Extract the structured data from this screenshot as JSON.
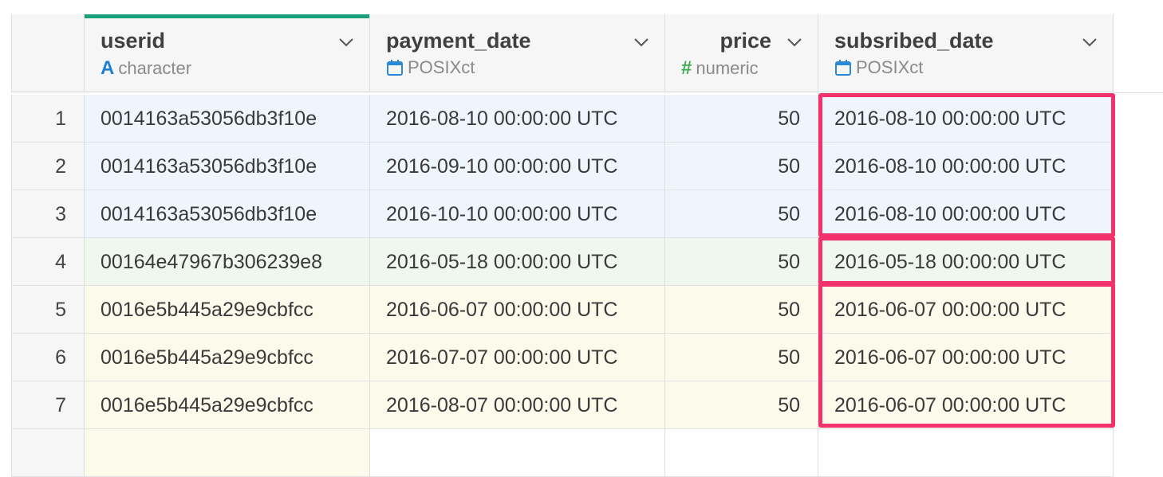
{
  "columns": [
    {
      "name": "userid",
      "type": "character",
      "type_icon": "character-type-icon",
      "type_glyph": "A",
      "active": true,
      "align": "left"
    },
    {
      "name": "payment_date",
      "type": "POSIXct",
      "type_icon": "calendar-icon",
      "type_glyph": "",
      "active": false,
      "align": "left"
    },
    {
      "name": "price",
      "type": "numeric",
      "type_icon": "numeric-type-icon",
      "type_glyph": "#",
      "active": false,
      "align": "right"
    },
    {
      "name": "subsribed_date",
      "type": "POSIXct",
      "type_icon": "calendar-icon",
      "type_glyph": "",
      "active": false,
      "align": "left"
    }
  ],
  "rows": [
    {
      "num": "1",
      "userid": "0014163a53056db3f10e",
      "payment_date": "2016-08-10 00:00:00 UTC",
      "price": "50",
      "subsribed_date": "2016-08-10 00:00:00 UTC",
      "group": "blue"
    },
    {
      "num": "2",
      "userid": "0014163a53056db3f10e",
      "payment_date": "2016-09-10 00:00:00 UTC",
      "price": "50",
      "subsribed_date": "2016-08-10 00:00:00 UTC",
      "group": "blue"
    },
    {
      "num": "3",
      "userid": "0014163a53056db3f10e",
      "payment_date": "2016-10-10 00:00:00 UTC",
      "price": "50",
      "subsribed_date": "2016-08-10 00:00:00 UTC",
      "group": "blue"
    },
    {
      "num": "4",
      "userid": "00164e47967b306239e8",
      "payment_date": "2016-05-18 00:00:00 UTC",
      "price": "50",
      "subsribed_date": "2016-05-18 00:00:00 UTC",
      "group": "green"
    },
    {
      "num": "5",
      "userid": "0016e5b445a29e9cbfcc",
      "payment_date": "2016-06-07 00:00:00 UTC",
      "price": "50",
      "subsribed_date": "2016-06-07 00:00:00 UTC",
      "group": "yellow"
    },
    {
      "num": "6",
      "userid": "0016e5b445a29e9cbfcc",
      "payment_date": "2016-07-07 00:00:00 UTC",
      "price": "50",
      "subsribed_date": "2016-06-07 00:00:00 UTC",
      "group": "yellow"
    },
    {
      "num": "7",
      "userid": "0016e5b445a29e9cbfcc",
      "payment_date": "2016-08-07 00:00:00 UTC",
      "price": "50",
      "subsribed_date": "2016-06-07 00:00:00 UTC",
      "group": "yellow"
    }
  ],
  "highlight_groups": [
    {
      "column": "subsribed_date",
      "rows": [
        "1",
        "2",
        "3"
      ]
    },
    {
      "column": "subsribed_date",
      "rows": [
        "4"
      ]
    },
    {
      "column": "subsribed_date",
      "rows": [
        "5",
        "6",
        "7"
      ]
    }
  ],
  "colors": {
    "active_column_accent": "#1aa179",
    "highlight_border": "#f2326c",
    "group_blue": "#eef5fd",
    "group_green": "#f0f7ee",
    "group_yellow": "#fcfbeb",
    "character_icon": "#1e7fd0",
    "numeric_icon": "#3cab4b",
    "calendar_icon": "#2b8ad6"
  }
}
